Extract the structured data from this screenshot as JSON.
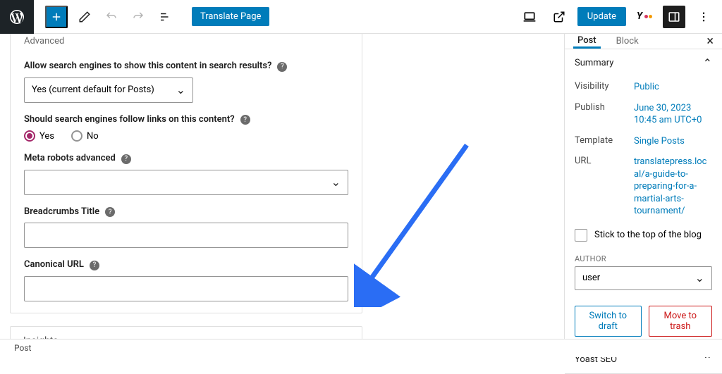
{
  "toolbar": {
    "translate_label": "Translate Page",
    "update_label": "Update"
  },
  "advanced": {
    "title": "Advanced",
    "allow_label": "Allow search engines to show this content in search results?",
    "allow_value": "Yes (current default for Posts)",
    "follow_label": "Should search engines follow links on this content?",
    "follow_options": {
      "yes": "Yes",
      "no": "No"
    },
    "meta_robots_label": "Meta robots advanced",
    "breadcrumbs_label": "Breadcrumbs Title",
    "canonical_label": "Canonical URL"
  },
  "insights_label": "Insights",
  "footer_crumb": "Post",
  "sidebar": {
    "tabs": {
      "post": "Post",
      "block": "Block"
    },
    "summary": {
      "title": "Summary",
      "visibility": {
        "label": "Visibility",
        "value": "Public"
      },
      "publish": {
        "label": "Publish",
        "value": "June 30, 2023 10:45 am UTC+0"
      },
      "template": {
        "label": "Template",
        "value": "Single Posts"
      },
      "url": {
        "label": "URL",
        "value": "translatepress.local/a-guide-to-preparing-for-a-martial-arts-tournament/"
      },
      "stick_label": "Stick to the top of the blog",
      "author_heading": "AUTHOR",
      "author_value": "user",
      "switch_draft": "Switch to draft",
      "move_trash": "Move to trash"
    },
    "yoast_label": "Yoast SEO"
  }
}
